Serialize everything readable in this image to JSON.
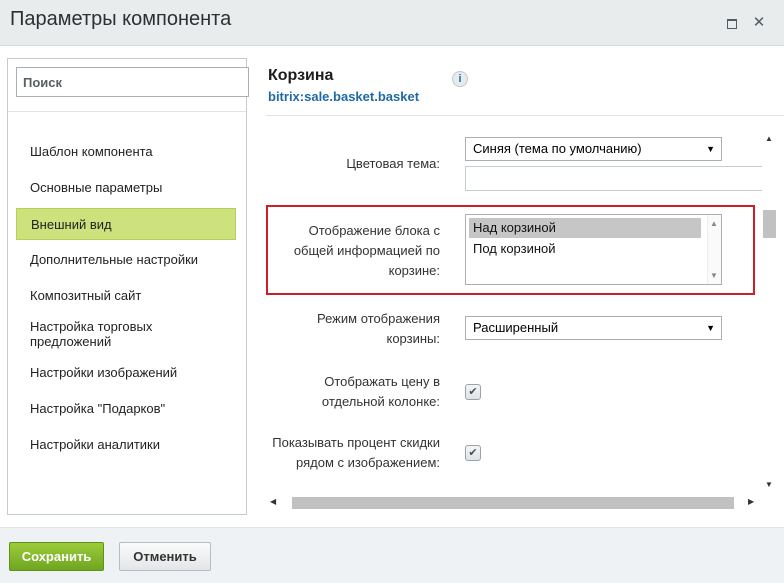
{
  "window": {
    "title": "Параметры компонента",
    "maximize_icon": "maximize-icon",
    "close_icon": "close-icon",
    "close_glyph": "✕"
  },
  "sidebar": {
    "search_placeholder": "Поиск",
    "items": [
      {
        "label": "Шаблон компонента",
        "active": false
      },
      {
        "label": "Основные параметры",
        "active": false
      },
      {
        "label": "Внешний вид",
        "active": true
      },
      {
        "label": "Дополнительные настройки",
        "active": false
      },
      {
        "label": "Композитный сайт",
        "active": false
      },
      {
        "label": "Настройка торговых предложений",
        "active": false
      },
      {
        "label": "Настройки изображений",
        "active": false
      },
      {
        "label": "Настройка \"Подарков\"",
        "active": false
      },
      {
        "label": "Настройки аналитики",
        "active": false
      }
    ]
  },
  "component": {
    "name": "Корзина",
    "code": "bitrix:sale.basket.basket",
    "info_glyph": "i"
  },
  "params": {
    "color_theme": {
      "label": "Цветовая тема:",
      "value": "Синяя (тема по умолчанию)"
    },
    "total_block": {
      "label": "Отображение блока с общей информацией по корзине:",
      "options": [
        "Над корзиной",
        "Под корзиной"
      ],
      "selected": "Над корзиной"
    },
    "display_mode": {
      "label": "Режим отображения корзины:",
      "value": "Расширенный"
    },
    "price_column": {
      "label": "Отображать цену в отдельной колонке:",
      "checked": true
    },
    "discount_percent": {
      "label": "Показывать процент скидки рядом с изображением:",
      "checked": true
    }
  },
  "footer": {
    "save_label": "Сохранить",
    "cancel_label": "Отменить"
  },
  "colors": {
    "active_nav": "#cde17c",
    "highlight_border": "#cd1f2a",
    "save_button": "#7cb82f",
    "link_blue": "#1f6aa5"
  }
}
